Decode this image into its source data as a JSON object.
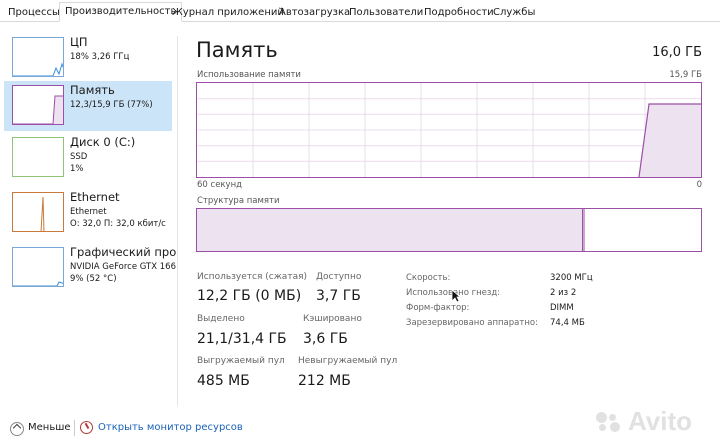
{
  "tabs": [
    "Процессы",
    "Производительность",
    "Журнал приложений",
    "Автозагрузка",
    "Пользователи",
    "Подробности",
    "Службы"
  ],
  "sidebar": {
    "items": [
      {
        "title": "ЦП",
        "sub1": "18% 3,26 ГГц",
        "sub2": "",
        "sub3": "",
        "color": "#3b8ed8"
      },
      {
        "title": "Память",
        "sub1": "12,3/15,9 ГБ (77%)",
        "sub2": "",
        "sub3": "",
        "color": "#9b4fa6"
      },
      {
        "title": "Диск 0 (C:)",
        "sub1": "SSD",
        "sub2": "1%",
        "sub3": "",
        "color": "#6aa84f"
      },
      {
        "title": "Ethernet",
        "sub1": "Ethernet",
        "sub2": "О: 32,0 П: 32,0 кбит/с",
        "sub3": "",
        "color": "#c97a3a"
      },
      {
        "title": "Графический про",
        "sub1": "NVIDIA GeForce GTX 166",
        "sub2": "9% (52 °C)",
        "sub3": "",
        "color": "#3b8ed8"
      }
    ]
  },
  "main": {
    "title": "Память",
    "total": "16,0 ГБ",
    "usage_label": "Использование памяти",
    "usage_max": "15,9 ГБ",
    "time_left": "60 секунд",
    "time_right": "0",
    "structure_label": "Структура памяти",
    "usage_fraction": 0.77
  },
  "stats": {
    "in_use_label": "Используется (сжатая)",
    "in_use_value": "12,2 ГБ (0 МБ)",
    "available_label": "Доступно",
    "available_value": "3,7 ГБ",
    "committed_label": "Выделено",
    "committed_value": "21,1/31,4 ГБ",
    "cached_label": "Кэшировано",
    "cached_value": "3,6 ГБ",
    "paged_label": "Выгружаемый пул",
    "paged_value": "485 МБ",
    "nonpaged_label": "Невыгружаемый пул",
    "nonpaged_value": "212 МБ"
  },
  "details": [
    {
      "label": "Скорость:",
      "value": "3200 МГц"
    },
    {
      "label": "Использовано гнезд:",
      "value": "2 из 2"
    },
    {
      "label": "Форм-фактор:",
      "value": "DIMM"
    },
    {
      "label": "Зарезервировано аппаратно:",
      "value": "74,4 МБ"
    }
  ],
  "bottom": {
    "fewer_label": "Меньше",
    "resmon_label": "Открыть монитор ресурсов"
  },
  "watermark": "Avito",
  "colors": {
    "memory": "#9b4fa6",
    "cpu": "#3b8ed8",
    "disk": "#6aa84f",
    "ethernet": "#c97a3a",
    "link": "#1a63b8",
    "selection": "#cce4f7"
  }
}
